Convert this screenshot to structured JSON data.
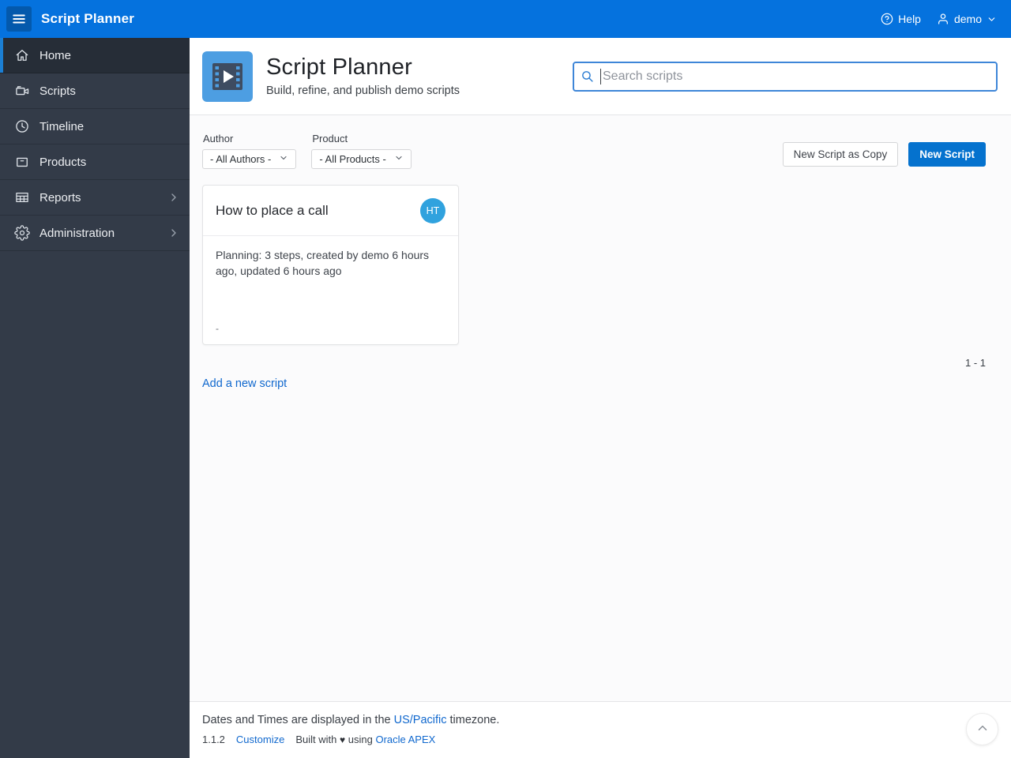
{
  "colors": {
    "header_blue": "#0572DE",
    "sidebar_bg": "#333B48",
    "primary_button_blue": "#0572CE",
    "link_blue": "#1068CE",
    "avatar_blue": "#30A2DE",
    "app_icon_blue": "#4D9EE2"
  },
  "header": {
    "app_title": "Script Planner",
    "help_label": "Help",
    "user_label": "demo"
  },
  "sidebar": {
    "items": [
      {
        "label": "Home",
        "icon": "home-icon",
        "active": true,
        "has_submenu": false
      },
      {
        "label": "Scripts",
        "icon": "video-camera-icon",
        "active": false,
        "has_submenu": false
      },
      {
        "label": "Timeline",
        "icon": "clock-icon",
        "active": false,
        "has_submenu": false
      },
      {
        "label": "Products",
        "icon": "box-icon",
        "active": false,
        "has_submenu": false
      },
      {
        "label": "Reports",
        "icon": "table-icon",
        "active": false,
        "has_submenu": true
      },
      {
        "label": "Administration",
        "icon": "gear-icon",
        "active": false,
        "has_submenu": true
      }
    ]
  },
  "hero": {
    "title": "Script Planner",
    "subtitle": "Build, refine, and publish demo scripts",
    "search_placeholder": "Search scripts"
  },
  "filters": {
    "author": {
      "label": "Author",
      "value": "- All Authors -"
    },
    "product": {
      "label": "Product",
      "value": "- All Products -"
    }
  },
  "toolbar": {
    "copy_button_label": "New Script as Copy",
    "new_button_label": "New Script"
  },
  "cards": [
    {
      "title": "How to place a call",
      "avatar_initials": "HT",
      "body": "Planning: 3 steps, created by demo 6 hours ago, updated 6 hours ago",
      "footer_text": "-"
    }
  ],
  "pagination_label": "1 - 1",
  "add_link_label": "Add a new script",
  "footer": {
    "timezone_prefix": "Dates and Times are displayed in the ",
    "timezone_link": "US/Pacific",
    "timezone_suffix": " timezone.",
    "version": "1.1.2",
    "customize_link": "Customize",
    "built_prefix": "Built with",
    "heart": "♥",
    "built_middle": "using",
    "apex_link": "Oracle APEX"
  }
}
